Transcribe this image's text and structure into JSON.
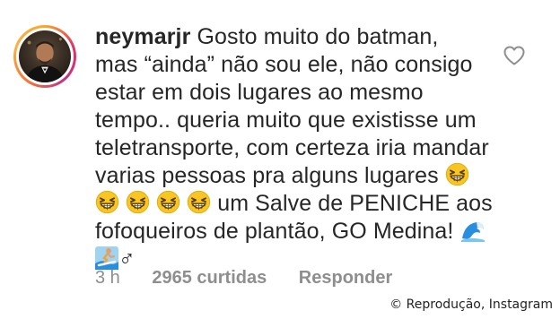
{
  "comment": {
    "username": "neymarjr",
    "lines": [
      "Gosto muito do batman,",
      "mas “ainda” não sou ele, não consigo",
      "estar em dois lugares ao mesmo",
      "tempo.. queria muito que existisse um",
      "teletransporte, com certeza iria mandar",
      "varias pessoas pra alguns lugares",
      "um Salve de PENICHE aos",
      "fofoqueiros de plantão, GO Medina!",
      "♂"
    ],
    "time": "3 h",
    "likes": "2965 curtidas",
    "reply_label": "Responder"
  },
  "credit": "© Reprodução, Instagram",
  "icons": {
    "like": "heart-outline-icon",
    "emoji_laugh": "grinning-squinting-face-emoji",
    "emoji_wave": "water-wave-emoji",
    "emoji_surfer": "surfer-emoji"
  },
  "colors": {
    "text": "#262626",
    "meta": "#8e8e8e",
    "emoji_yellow": "#f7c625",
    "wave_blue": "#2a8ee0"
  }
}
